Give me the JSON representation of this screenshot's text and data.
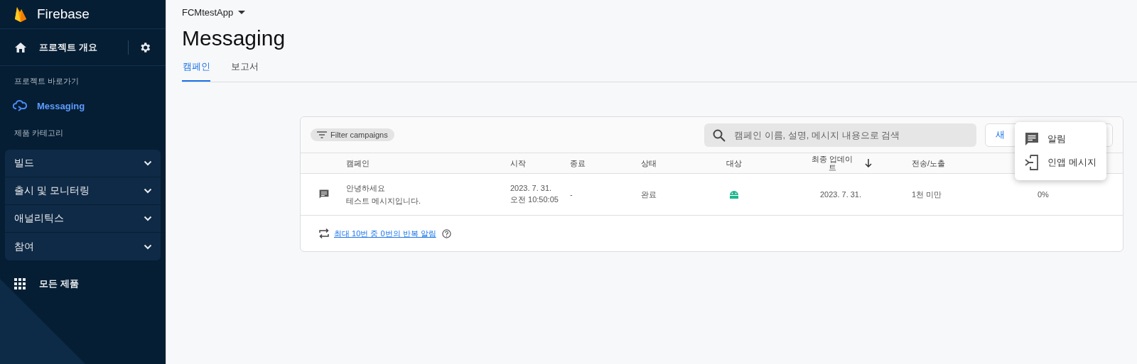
{
  "sidebar": {
    "brand": "Firebase",
    "overview": "프로젝트 개요",
    "shortcuts_label": "프로젝트 바로가기",
    "shortcuts": [
      {
        "label": "Messaging",
        "selected": true
      }
    ],
    "categories_label": "제품 카테고리",
    "categories": [
      {
        "label": "빌드",
        "expanded": false
      },
      {
        "label": "출시 및 모니터링",
        "expanded": false
      },
      {
        "label": "애널리틱스",
        "expanded": false
      },
      {
        "label": "참여",
        "expanded": false
      }
    ],
    "all_products": "모든 제품"
  },
  "header": {
    "project": "FCMtestApp",
    "title": "Messaging",
    "tabs": [
      {
        "label": "캠페인",
        "selected": true
      },
      {
        "label": "보고서",
        "selected": false
      }
    ]
  },
  "toolbar": {
    "filter": "Filter campaigns",
    "search_placeholder": "캠페인 이름, 설명, 메시지 내용으로 검색",
    "new_button": "새"
  },
  "table": {
    "columns": [
      "캠페인",
      "시작",
      "종료",
      "상태",
      "대상",
      "최종 업데이트",
      "전송/노출"
    ],
    "rows": [
      {
        "title": "안녕하세요",
        "description": "테스트 메시지입니다.",
        "start": [
          "2023. 7. 31.",
          "오전 10:50:05"
        ],
        "end": "-",
        "status": "완료",
        "target": {
          "kind": "android"
        },
        "last_update": "2023. 7. 31.",
        "sends": "1천 미만",
        "column_9": "0%"
      }
    ]
  },
  "footer": {
    "link": "최대 10번 중 0번의 반복 알림"
  },
  "menu": [
    {
      "kind": "notification",
      "label": "알림"
    },
    {
      "kind": "in_app",
      "label": "인앱 메시지"
    }
  ]
}
